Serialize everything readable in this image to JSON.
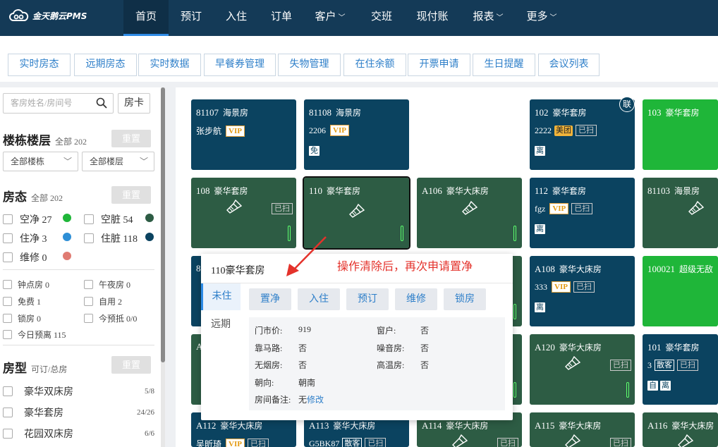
{
  "app": {
    "logo_text": "金天鹅云PMS"
  },
  "nav": {
    "items": [
      "首页",
      "预订",
      "入住",
      "订单",
      "客户",
      "交班",
      "现付账",
      "报表",
      "更多"
    ],
    "active": "首页"
  },
  "subtabs": [
    "实时房态",
    "远期房态",
    "实时数据",
    "早餐券管理",
    "失物管理",
    "在住余额",
    "开票申请",
    "生日提醒",
    "会议列表"
  ],
  "sidebar": {
    "search_placeholder": "客房姓名/房间号",
    "room_card_btn": "房卡",
    "building": {
      "title": "楼栋楼层",
      "sub": "全部 202",
      "reset": "重置",
      "building_select": "全部楼栋",
      "floor_select": "全部楼层"
    },
    "status": {
      "title": "房态",
      "sub": "全部 202",
      "reset": "重置",
      "items": [
        {
          "label": "空净 27",
          "color": "#1fb639"
        },
        {
          "label": "空脏 54",
          "color": "#2d5c44"
        },
        {
          "label": "住净 3",
          "color": "#2e8fd6"
        },
        {
          "label": "住脏 118",
          "color": "#0b4360"
        },
        {
          "label": "维修 0",
          "color": "#e07b72"
        }
      ]
    },
    "filters": [
      "钟点房 0",
      "午夜房 0",
      "免费 1",
      "自用 2",
      "锁房 0",
      "今预抵 0/0",
      "今日预离 115"
    ],
    "roomtype": {
      "title": "房型",
      "sub": "可订/总房",
      "reset": "重置",
      "items": [
        {
          "label": "豪华双床房",
          "count": "5/8"
        },
        {
          "label": "豪华套房",
          "count": "24/26"
        },
        {
          "label": "花园双床房",
          "count": "6/6"
        }
      ]
    }
  },
  "rooms": {
    "r81107": {
      "no": "81107",
      "type": "海景房",
      "guest": "张步航",
      "vip": "VIP"
    },
    "r81108": {
      "no": "81108",
      "type": "海景房",
      "guest": "2206",
      "vip": "VIP",
      "tag": "免"
    },
    "r102": {
      "no": "102",
      "type": "豪华套房",
      "guest": "2222",
      "meituan": "美团",
      "scanned": "已扫",
      "tag": "离",
      "lian": "联"
    },
    "r103": {
      "no": "103",
      "type": "豪华套房"
    },
    "r108": {
      "no": "108",
      "type": "豪华套房",
      "scanned": "已扫"
    },
    "r110": {
      "no": "110",
      "type": "豪华套房"
    },
    "rA106": {
      "no": "A106",
      "type": "豪华大床房"
    },
    "r112": {
      "no": "112",
      "type": "豪华套房",
      "guest": "fgz",
      "vip": "VIP",
      "scanned": "已扫",
      "tag": "离"
    },
    "r81103": {
      "no": "81103",
      "type": "海景房"
    },
    "r8x": {
      "no": "8"
    },
    "rA108": {
      "no": "A108",
      "type": "豪华大床房",
      "guest": "333",
      "vip": "VIP",
      "scanned": "已扫",
      "tag": "离"
    },
    "r100021": {
      "no": "100021",
      "type": "超级无敌"
    },
    "rAx": {
      "no": "A"
    },
    "rA120": {
      "no": "A120",
      "type": "豪华大床房",
      "scanned": "已扫"
    },
    "r101": {
      "no": "101",
      "type": "豪华套房",
      "guest": "3",
      "sanke": "散客",
      "scanned": "已扫",
      "tag1": "自",
      "tag2": "离"
    },
    "rA112": {
      "no": "A112",
      "type": "豪华大床房",
      "guest": "吴昕琦",
      "vip": "VIP",
      "scanned": "已扫"
    },
    "rA113": {
      "no": "A113",
      "type": "豪华大床房",
      "guest": "G5BK87",
      "sanke": "散客",
      "scanned": "已扫"
    },
    "rA114": {
      "no": "A114",
      "type": "豪华大床房",
      "scanned": "已扫"
    },
    "rA115": {
      "no": "A115",
      "type": "豪华大床房",
      "scanned": "已扫"
    },
    "rA116": {
      "no": "A116",
      "type": "豪华大床房"
    }
  },
  "popup": {
    "title": "110豪华套房",
    "tabs": [
      "未住",
      "远期"
    ],
    "buttons": [
      "置净",
      "入住",
      "预订",
      "维修",
      "锁房"
    ],
    "info": [
      {
        "k": "门市价:",
        "v": "919"
      },
      {
        "k": "窗户:",
        "v": "否"
      },
      {
        "k": "靠马路:",
        "v": "否"
      },
      {
        "k": "噪音房:",
        "v": "否"
      },
      {
        "k": "无烟房:",
        "v": "否"
      },
      {
        "k": "高温房:",
        "v": "否"
      },
      {
        "k": "朝向:",
        "v": "朝南"
      },
      {
        "k": "房间备注:",
        "v": "无",
        "edit": "修改"
      }
    ]
  },
  "annotation": {
    "text": "操作清除后，再次申请置净",
    "color": "#e4322b"
  },
  "colors": {
    "topbar": "#143a57",
    "accent": "#2e7fc9",
    "room_dirty_occupied": "#0b4360",
    "room_dirty_vacant": "#2d5c44",
    "room_clean_vacant": "#1fb639"
  }
}
